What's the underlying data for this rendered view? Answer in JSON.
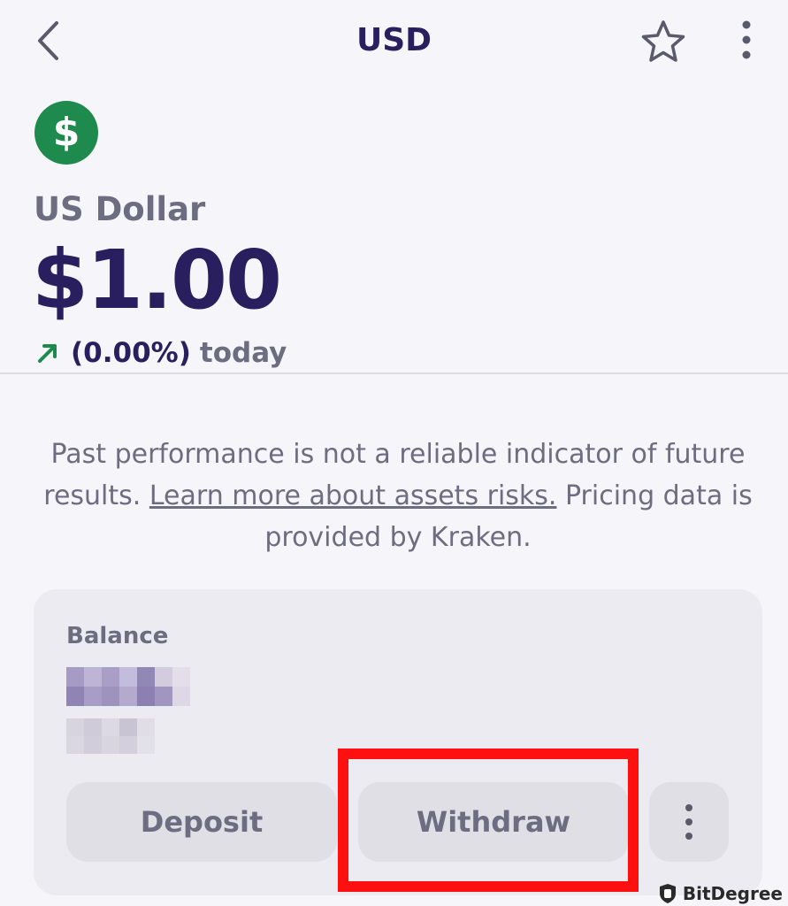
{
  "header": {
    "title": "USD",
    "back_icon": "chevron-left-icon",
    "favorite_icon": "star-icon",
    "more_icon": "vertical-dots-icon"
  },
  "asset": {
    "symbol_glyph": "$",
    "name": "US Dollar",
    "price": "$1.00",
    "change_percent": "(0.00%)",
    "change_period": "today",
    "change_direction": "up",
    "accent_color": "#1e8a4d"
  },
  "disclaimer": {
    "text_before": "Past performance is not a reliable indicator of future results. ",
    "link": "Learn more about assets risks.",
    "text_after": " Pricing data is provided by Kraken."
  },
  "balance": {
    "label": "Balance",
    "deposit_label": "Deposit",
    "withdraw_label": "Withdraw",
    "more_icon": "vertical-dots-icon"
  },
  "annotation": {
    "highlight_color": "#ff1010",
    "highlighted": "Withdraw"
  },
  "watermark": {
    "text": "BitDegree"
  }
}
